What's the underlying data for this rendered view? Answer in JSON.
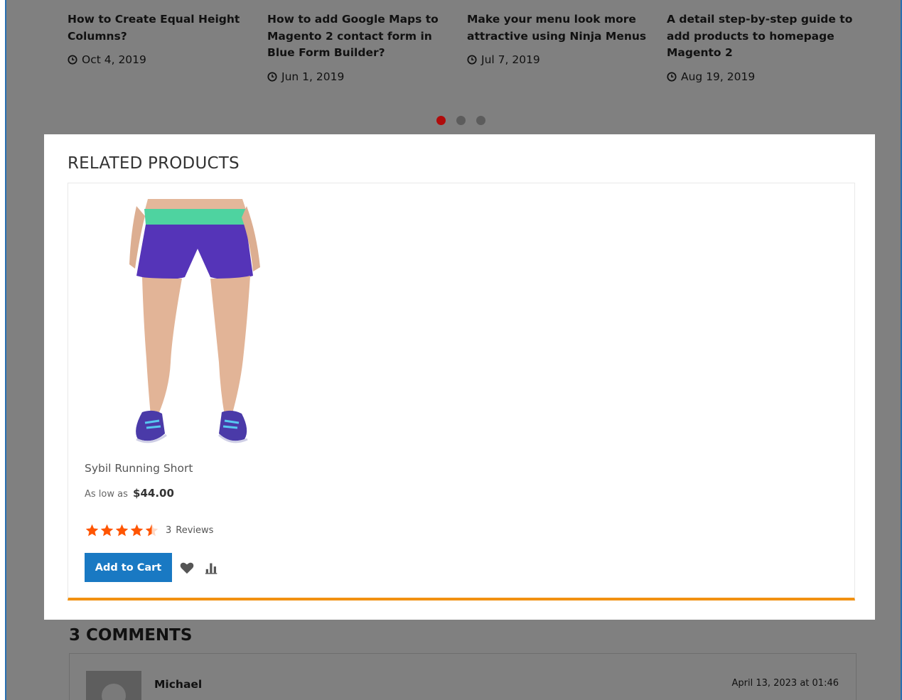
{
  "blog_posts": [
    {
      "title": "How to Create Equal Height Columns?",
      "date": "Oct 4, 2019"
    },
    {
      "title": "How to add Google Maps to Magento 2 contact form in Blue Form Builder?",
      "date": "Jun 1, 2019"
    },
    {
      "title": "Make your menu look more attractive using Ninja Menus",
      "date": "Jul 7, 2019"
    },
    {
      "title": "A detail step-by-step guide to add products to homepage Magento 2",
      "date": "Aug 19, 2019"
    }
  ],
  "carousel": {
    "pages": 3,
    "active_index": 0
  },
  "related": {
    "title": "RELATED PRODUCTS",
    "products": [
      {
        "name": "Sybil Running Short",
        "price_prefix": "As low as",
        "price": "$44.00",
        "rating_stars": 4.5,
        "reviews_count": "3",
        "reviews_label": "Reviews",
        "add_to_cart_label": "Add to Cart",
        "image_description": "woman wearing purple running shorts with green waistband and purple sneakers"
      }
    ]
  },
  "comments": {
    "title": "3 COMMENTS",
    "items": [
      {
        "author": "Michael",
        "date": "April 13, 2023 at 01:46"
      }
    ]
  },
  "colors": {
    "overlay": "#808080",
    "accent_orange": "#f29111",
    "button_blue": "#1979c3",
    "star_orange": "#ff5501",
    "active_dot": "#b00b0b"
  },
  "icons": [
    "clock-icon",
    "star-icon",
    "wishlist-heart-icon",
    "compare-icon"
  ]
}
